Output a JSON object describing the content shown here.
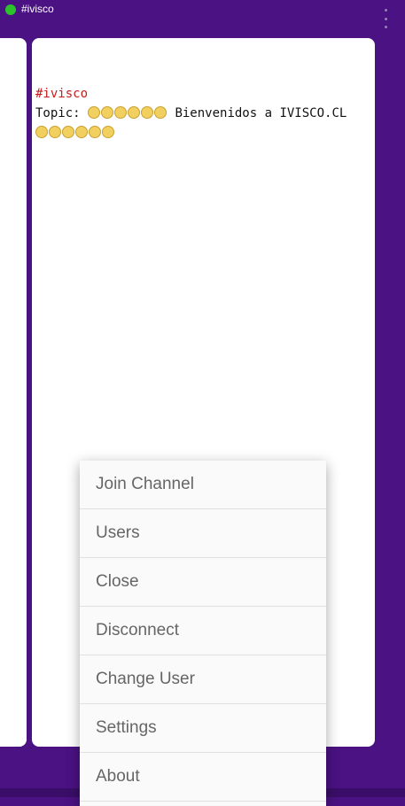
{
  "header": {
    "title": "#ivisco",
    "status_color": "#2bc22b",
    "overflow_icon": "more-vert-icon"
  },
  "chat": {
    "channel": "#ivisco",
    "topic_prefix": "Topic: ",
    "topic_text": " Bienvenidos a IVISCO.CL ",
    "emoji_icon": "smiley-icon"
  },
  "menu": {
    "items": [
      {
        "label": "Join Channel"
      },
      {
        "label": "Users"
      },
      {
        "label": "Close"
      },
      {
        "label": "Disconnect"
      },
      {
        "label": "Change User"
      },
      {
        "label": "Settings"
      },
      {
        "label": "About"
      }
    ]
  },
  "colors": {
    "background": "#4a1282",
    "channel_name": "#c41b1b"
  }
}
